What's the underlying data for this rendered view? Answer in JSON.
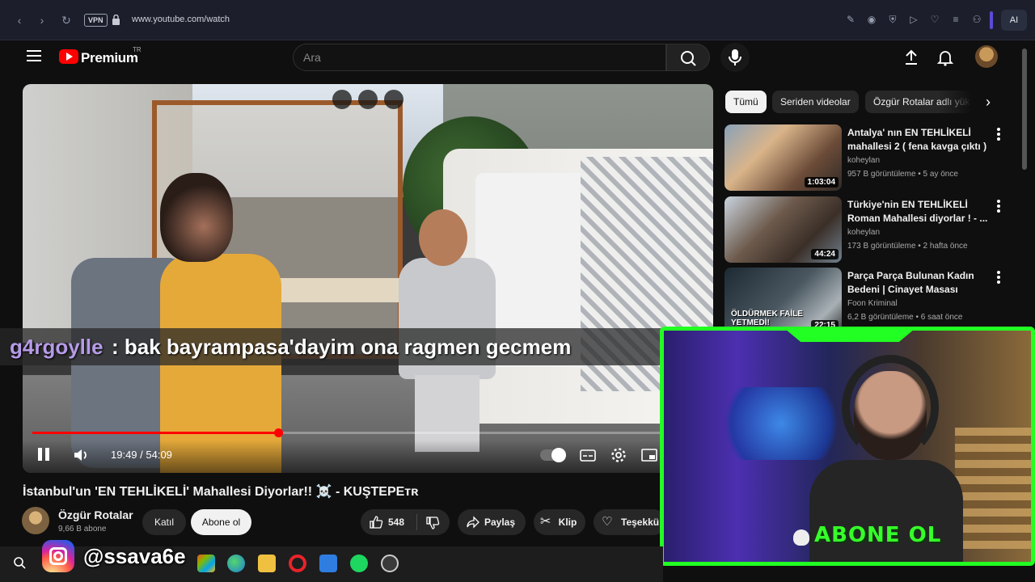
{
  "browser": {
    "url": "www.youtube.com/watch",
    "vpn_label": "VPN",
    "ai_label": "AI"
  },
  "masthead": {
    "brand": "Premium",
    "region": "TR",
    "search_placeholder": "Ara"
  },
  "player": {
    "time": "19:49 / 54:09",
    "progress": 0.366
  },
  "chat": {
    "user": "g4rgoylle",
    "message": ": bak bayrampasa'dayim ona ragmen gecmem"
  },
  "video": {
    "title": "İstanbul'un 'EN TEHLİKELİ' Mahallesi Diyorlar!! ☠️ - KUŞTEPEᴛʀ",
    "channel": "Özgür Rotalar",
    "subscribers": "9,66 B abone",
    "join_label": "Katıl",
    "subscribe_label": "Abone ol",
    "likes": "548",
    "share_label": "Paylaş",
    "clip_label": "Klip",
    "thanks_label": "Teşekkü"
  },
  "chips": [
    "Tümü",
    "Seriden videolar",
    "Özgür Rotalar adlı yük"
  ],
  "recommendations": [
    {
      "title": "Antalya' nın EN TEHLİKELİ mahallesi 2 ( fena kavga çıktı )",
      "channel": "koheylan",
      "meta": "957 B görüntüleme • 5 ay önce",
      "duration": "1:03:04"
    },
    {
      "title": "Türkiye'nin EN TEHLİKELİ Roman Mahallesi diyorlar ! - ...",
      "channel": "koheylan",
      "meta": "173 B görüntüleme • 2 hafta önce",
      "duration": "44:24"
    },
    {
      "title": "Parça Parça Bulunan Kadın Bedeni | Cinayet Masası",
      "channel": "Foon Kriminal",
      "meta": "6,2 B görüntüleme • 6 saat önce",
      "duration": "22:15",
      "thumb_text": "ÖLDÜRMEK FAİLE YETMEDİ!"
    }
  ],
  "overlay": {
    "abone_text": "ABONE OL",
    "instagram_handle": "@ssava6e"
  },
  "colors": {
    "accent_red": "#ff0000",
    "cam_border": "#22ff22",
    "chat_user": "#b69be8"
  }
}
